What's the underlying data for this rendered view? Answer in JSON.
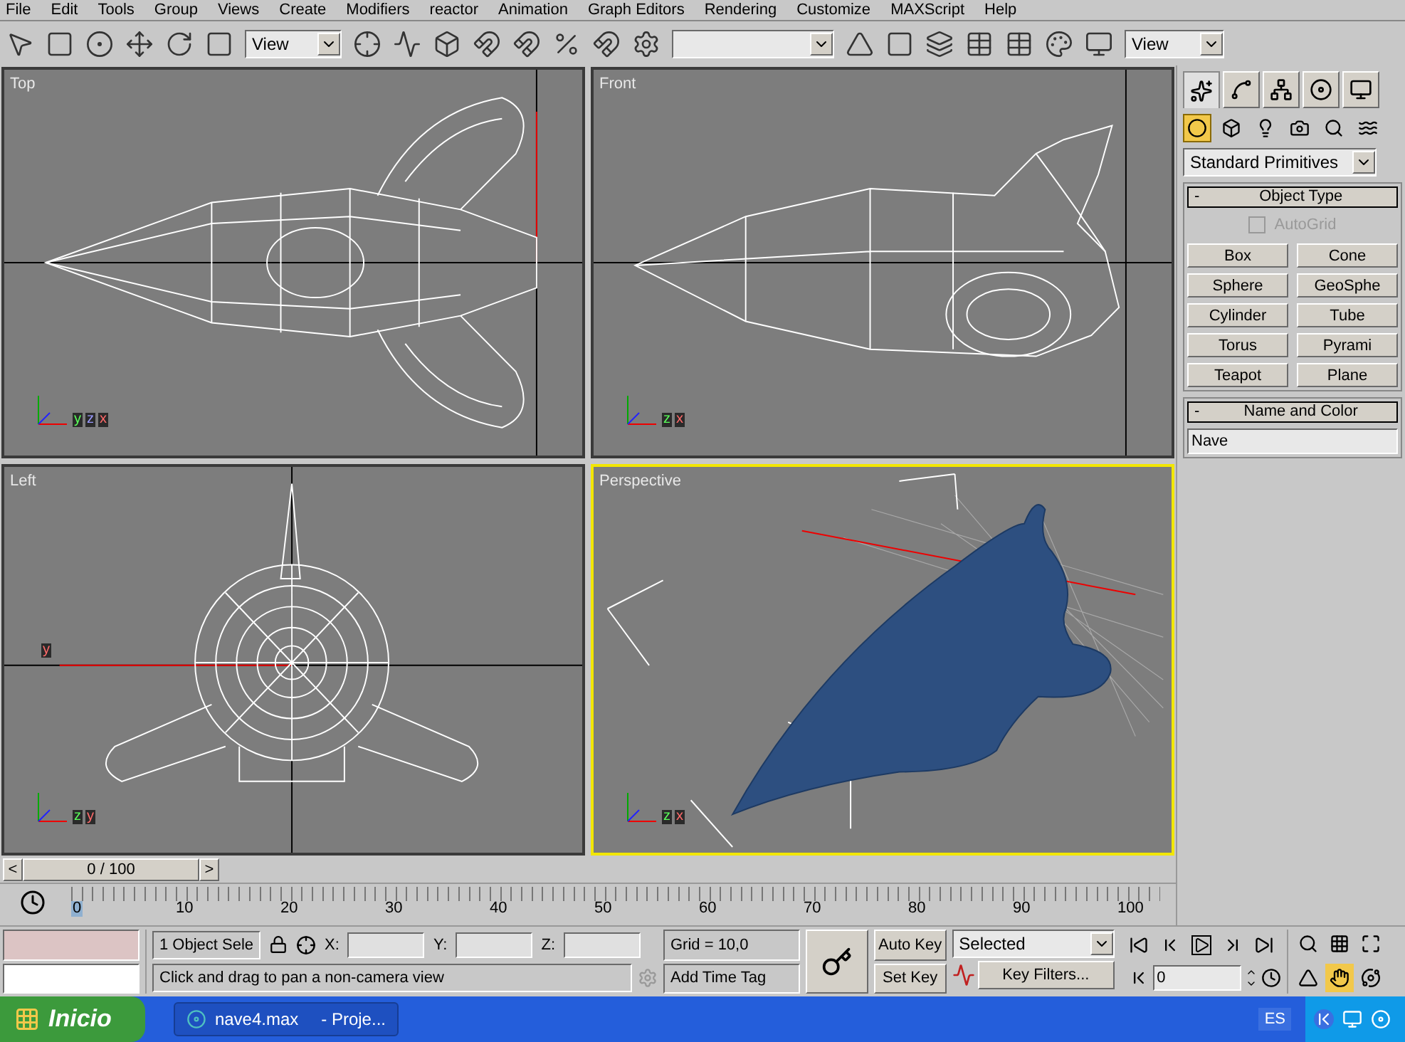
{
  "menu_bar": [
    "File",
    "Edit",
    "Tools",
    "Group",
    "Views",
    "Create",
    "Modifiers",
    "reactor",
    "Animation",
    "Graph Editors",
    "Rendering",
    "Customize",
    "MAXScript",
    "Help"
  ],
  "toolbar": {
    "dropdowns": [
      "View",
      "View"
    ]
  },
  "viewports": [
    {
      "label": "Top",
      "kind": "top",
      "selected": false,
      "axis_labels": [
        "y",
        "z",
        "x"
      ]
    },
    {
      "label": "Front",
      "kind": "front",
      "selected": false,
      "axis_labels": [
        "z",
        "x"
      ]
    },
    {
      "label": "Left",
      "kind": "left",
      "selected": false,
      "axis_labels": [
        "z",
        "y"
      ],
      "center_label": "y"
    },
    {
      "label": "Perspective",
      "kind": "perspective",
      "selected": true,
      "axis_labels": [
        "z",
        "x"
      ]
    }
  ],
  "command_panel": {
    "tabs": [
      {
        "selected": true
      },
      {
        "selected": false
      },
      {
        "selected": false
      },
      {
        "selected": false
      },
      {
        "selected": false
      }
    ],
    "subtabs": [
      {
        "selected": true
      },
      {
        "selected": false
      },
      {
        "selected": false
      },
      {
        "selected": false
      },
      {
        "selected": false
      },
      {
        "selected": false
      }
    ],
    "category": "Standard Primitives",
    "object_type": {
      "title": "Object Type",
      "collapse": "-",
      "autogrid": {
        "label": "AutoGrid",
        "checked": false,
        "disabled": true
      },
      "buttons": [
        "Box",
        "Cone",
        "Sphere",
        "GeoSphe",
        "Cylinder",
        "Tube",
        "Torus",
        "Pyrami",
        "Teapot",
        "Plane"
      ]
    },
    "name_and_color": {
      "title": "Name and Color",
      "collapse": "-",
      "name": "Nave"
    }
  },
  "time_slider": {
    "prev": "<",
    "label": "0 / 100",
    "next": ">",
    "level": 0
  },
  "track_bar": [
    "0",
    "10",
    "20",
    "30",
    "40",
    "50",
    "60",
    "70",
    "80",
    "90",
    "100"
  ],
  "status": {
    "selection": "1 Object Sele",
    "x_label": "X:",
    "y_label": "Y:",
    "z_label": "Z:",
    "grid": "Grid = 10,0",
    "prompt": "Click and drag to pan a non-camera view",
    "time_tag": "Add Time Tag",
    "auto_key": "Auto Key",
    "set_key": "Set Key",
    "key_mode": "Selected",
    "key_filters": "Key Filters...",
    "frame": "0"
  },
  "viewport_nav": [
    {
      "selected": false
    },
    {
      "selected": false
    },
    {
      "selected": false
    },
    {
      "selected": false
    },
    {
      "selected": true
    },
    {
      "selected": false
    }
  ],
  "taskbar": {
    "start": "Inicio",
    "task_title": "nave4.max",
    "task_suffix": "- Proje...",
    "language": "ES"
  }
}
